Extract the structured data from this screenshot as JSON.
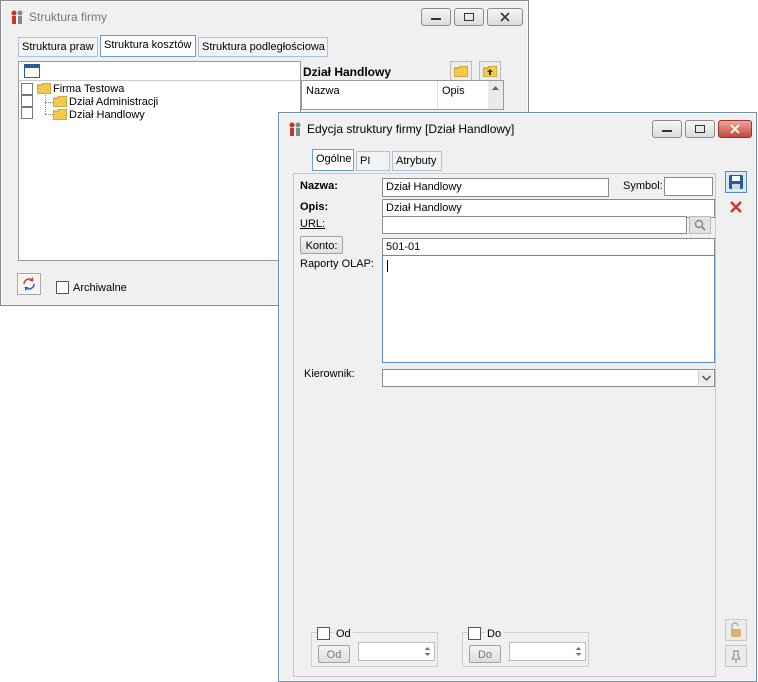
{
  "back_window": {
    "title": "Struktura firmy",
    "tabs": [
      "Struktura praw",
      "Struktura kosztów",
      "Struktura podległościowa"
    ],
    "tree": {
      "root": "Firma Testowa",
      "children": [
        "Dział Administracji",
        "Dział Handlowy"
      ]
    },
    "detail_title": "Dział Handlowy",
    "columns": [
      "Nazwa",
      "Opis"
    ],
    "archive_label": "Archiwalne"
  },
  "edit_window": {
    "title": "Edycja struktury firmy [Dział Handlowy]",
    "tabs": [
      "Ogólne",
      "PI",
      "Atrybuty"
    ],
    "labels": {
      "nazwa": "Nazwa:",
      "symbol": "Symbol:",
      "opis": "Opis:",
      "url": "URL:",
      "konto": "Konto:",
      "raporty": "Raporty OLAP:",
      "kierownik": "Kierownik:",
      "od": "Od",
      "do": "Do"
    },
    "values": {
      "nazwa": "Dział Handlowy",
      "symbol": "",
      "opis": "Dział Handlowy",
      "url": "",
      "konto": "501-01",
      "raporty": "",
      "kierownik": "",
      "od_date": "",
      "do_date": ""
    },
    "buttons": {
      "od": "Od",
      "do": "Do"
    }
  },
  "colors": {
    "active_tab_border": "#6b9fd4",
    "close_button": "#c8453a",
    "folder": "#f2c94c"
  }
}
